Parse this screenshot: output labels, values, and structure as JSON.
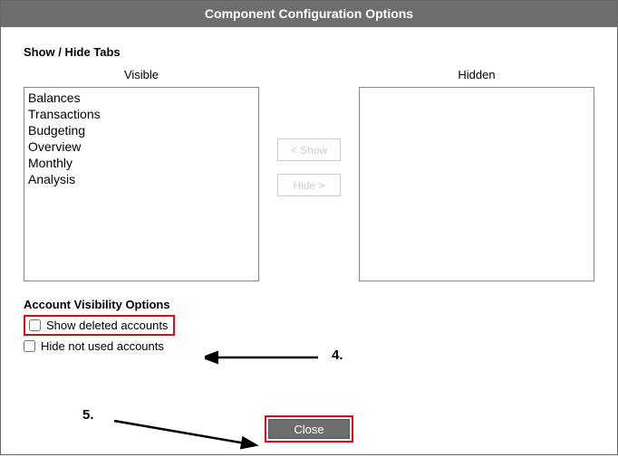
{
  "title": "Component Configuration Options",
  "section_show_hide": "Show / Hide Tabs",
  "visible_label": "Visible",
  "hidden_label": "Hidden",
  "visible_items": [
    "Balances",
    "Transactions",
    "Budgeting",
    "Overview",
    "Monthly",
    "Analysis"
  ],
  "hidden_items": [],
  "buttons": {
    "show": "< Show",
    "hide": "Hide >"
  },
  "acct_section": "Account Visibility Options",
  "checkboxes": {
    "show_deleted": "Show deleted accounts",
    "hide_unused": "Hide not used accounts"
  },
  "close": "Close",
  "annotations": {
    "step4": "4.",
    "step5": "5."
  }
}
